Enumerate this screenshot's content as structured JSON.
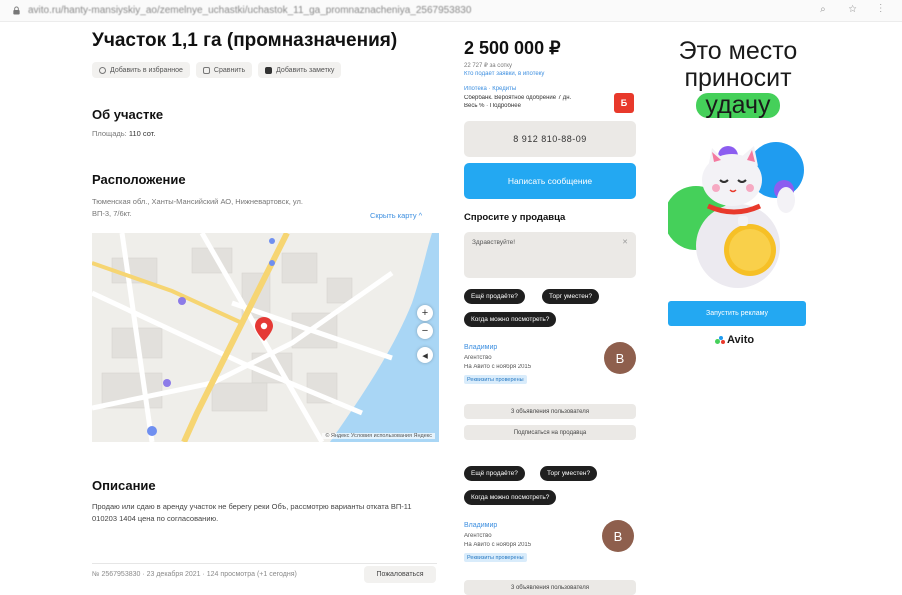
{
  "browser": {
    "url": "avito.ru/hanty-mansiyskiy_ao/zemelnye_uchastki/uchastok_11_ga_promnaznacheniya_2567953830"
  },
  "listing": {
    "title": "Участок 1,1 га (промназначения)",
    "actions": [
      "Добавить в избранное",
      "Сравнить",
      "Добавить заметку"
    ],
    "about_heading": "Об участке",
    "area_label": "Площадь:",
    "area_value": "110 сот.",
    "location_heading": "Расположение",
    "address_line1": "Тюменская обл., Ханты-Мансийский АО, Нижневартовск, ул.",
    "address_line2": "ВП-3, 7/6кт.",
    "show_map_link": "Скрыть карту ^",
    "map_attribution": "© Яндекс  Условия использования  Яндекс",
    "description_heading": "Описание",
    "description_text": "Продаю или сдаю в аренду участок не берегу реки Объ, рассмотрю варианты отката ВП-11 010203 1404 цена по согласованию.",
    "footer_meta": "№ 2567953830 · 23 декабря 2021 · 124 просмотра (+1 сегодня)",
    "complain_label": "Пожаловаться"
  },
  "sidebar": {
    "price": "2 500 000 ₽",
    "price_note_1": "22 727 ₽ за сотку",
    "price_note_2": "Кто подаёт заявки, в ипотеку",
    "promo_line_1": "Ипотека · Кредиты",
    "promo_line_2": "Сбербанк. Вероятное одобрение 7 дн.",
    "promo_line_3": "Весь % · Подробнее",
    "promo_badge": "Б",
    "phone_label": "8 912 810-88-09",
    "message_label": "Написать сообщение",
    "ask_heading": "Спросите у продавца",
    "ask_placeholder": "Здравствуйте!",
    "quick_questions_1": [
      "Ещё продаёте?",
      "Торг уместен?",
      "Когда можно посмотреть?"
    ],
    "seller_1": {
      "name": "Владимир",
      "role": "Агентство",
      "since": "На Авито с ноября 2015",
      "badge": "Реквизиты проверены",
      "avatar_letter": "В"
    },
    "subscribe_label": "Подписаться на продавца",
    "other_ads_label": "3 объявления пользователя",
    "quick_questions_2": [
      "Ещё продаёте?",
      "Торг уместен?",
      "Когда можно посмотреть?"
    ],
    "seller_2": {
      "name": "Владимир",
      "role": "Агентство",
      "since": "На Авито с ноября 2015",
      "badge": "Реквизиты проверены",
      "avatar_letter": "В"
    },
    "other_ads_label_2": "3 объявления пользователя"
  },
  "ad": {
    "line1": "Это место",
    "line2": "приносит",
    "highlight": "удачу",
    "button_label": "Запустить рекламу",
    "brand": "Avito"
  },
  "colors": {
    "accent_blue": "#23a8f2",
    "ad_green": "#45d05a",
    "badge_red": "#e8392b",
    "map_pin": "#e53935"
  }
}
